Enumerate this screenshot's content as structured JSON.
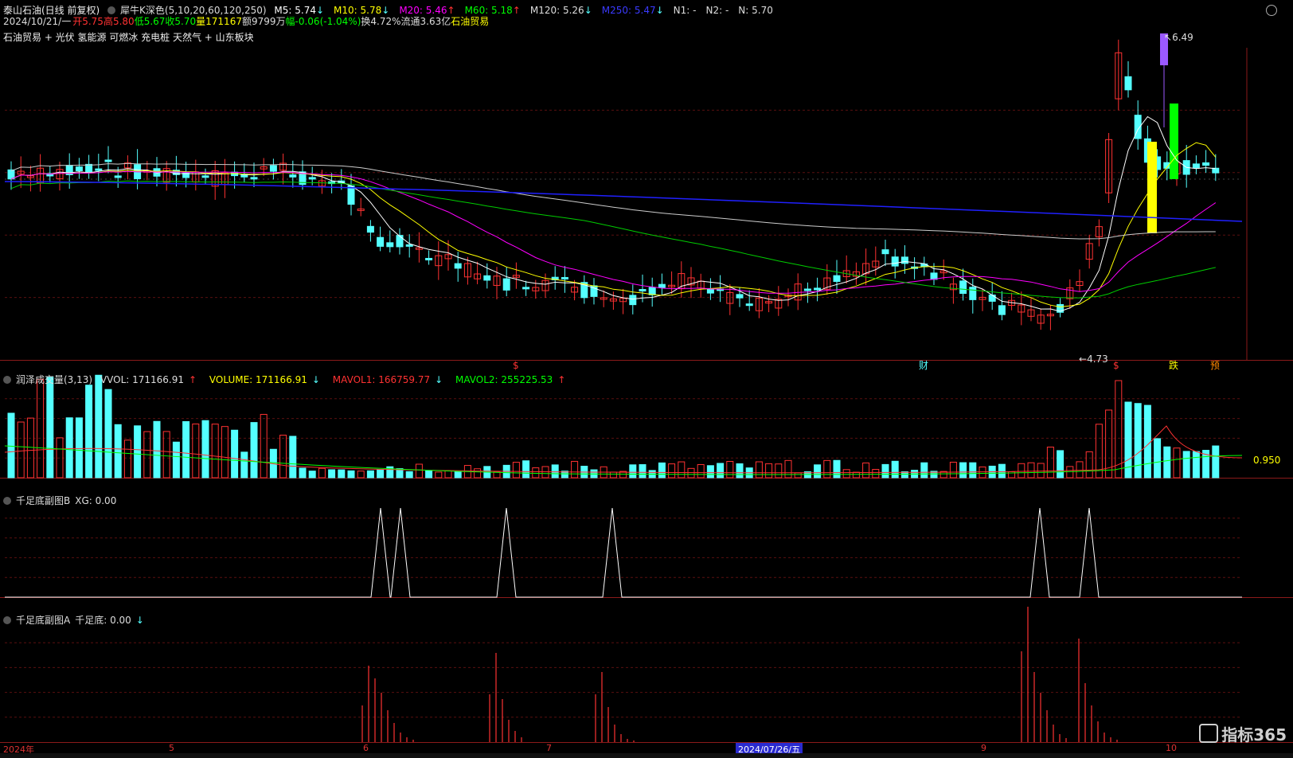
{
  "header": {
    "stock_title": "泰山石油(日线 前复权)",
    "indicator_name": "犀牛K深色(5,10,20,60,120,250)",
    "ma": [
      {
        "label": "M5: 5.74",
        "arrow": "↓",
        "color": "#ffffff"
      },
      {
        "label": "M10: 5.78",
        "arrow": "↓",
        "color": "#ffff00"
      },
      {
        "label": "M20: 5.46",
        "arrow": "↑",
        "color": "#ff00ff"
      },
      {
        "label": "M60: 5.18",
        "arrow": "↑",
        "color": "#00ff00"
      },
      {
        "label": "M120: 5.26",
        "arrow": "↓",
        "color": "#dddddd"
      },
      {
        "label": "M250: 5.47",
        "arrow": "↓",
        "color": "#3a3aff"
      },
      {
        "label": "N1: -",
        "arrow": "",
        "color": "#dddddd"
      },
      {
        "label": "N2: -",
        "arrow": "",
        "color": "#dddddd"
      },
      {
        "label": "N: 5.70",
        "arrow": "",
        "color": "#dddddd"
      }
    ],
    "date": "2024/10/21/一",
    "open": "开5.75",
    "high": "高5.80",
    "low": "低5.67",
    "close": "收5.70",
    "volume": "量171167",
    "amount": "额9799万",
    "change": "幅-0.06(-1.04%)",
    "turnover": "换4.72%",
    "float_cap": "流通3.63亿",
    "sector_tag": "石油贸易",
    "concepts": "石油贸易 + 光伏 氢能源 可燃冰 充电桩 天然气  + 山东板块"
  },
  "price_panel": {
    "high_label": "6.49",
    "low_label": "4.73",
    "markers": [
      "$",
      "财",
      "$",
      "跌",
      "预"
    ]
  },
  "volume_panel": {
    "title": "润泽成交量(3,13)",
    "vvol": "VVOL: 171166.91",
    "vvol_arrow": "↑",
    "volume": "VOLUME: 171166.91",
    "volume_arrow": "↓",
    "mavol1": "MAVOL1: 166759.77",
    "mavol1_arrow": "↓",
    "mavol2": "MAVOL2: 255225.53",
    "mavol2_arrow": "↑",
    "right_label": "0.950"
  },
  "sub_b": {
    "title": "千足底副图B",
    "value": "XG: 0.00"
  },
  "sub_a": {
    "title": "千足底副图A",
    "value": "千足底: 0.00",
    "arrow": "↓"
  },
  "axis": {
    "labels": [
      "2024年",
      "5",
      "6",
      "7",
      "2024/07/26/五",
      "9",
      "10"
    ]
  },
  "logo": {
    "text": "指标365"
  },
  "colors": {
    "up": "#ff3232",
    "down": "#54ffff",
    "ma5": "#ffffff",
    "ma10": "#ffff00",
    "ma20": "#ff00ff",
    "ma60": "#00cc00",
    "ma120": "#cccccc",
    "ma250": "#2020ff"
  }
}
